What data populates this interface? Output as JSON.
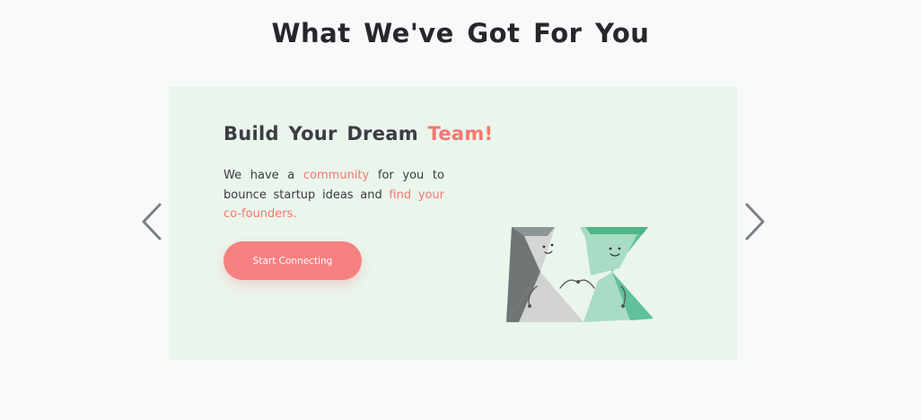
{
  "section": {
    "title": "What We've Got For You"
  },
  "carousel": {
    "prev_icon": "chevron-left-icon",
    "next_icon": "chevron-right-icon",
    "arrow_color": "#7d7f86"
  },
  "slide": {
    "title_main": "Build Your Dream ",
    "title_accent": "Team!",
    "description": {
      "part1": "We have a ",
      "link1": "community",
      "part2": " for you to bounce startup ideas and ",
      "link2": "find your co-founders."
    },
    "button_label": "Start Connecting",
    "illustration_icon": "team-hourglass-characters-illustration"
  },
  "colors": {
    "accent": "#f4776d",
    "button": "#f68180",
    "slide_background": "#eaf5ec",
    "page_background": "#f8f9fb",
    "character_gray": "#6f7475",
    "character_green": "#5fc29a"
  }
}
